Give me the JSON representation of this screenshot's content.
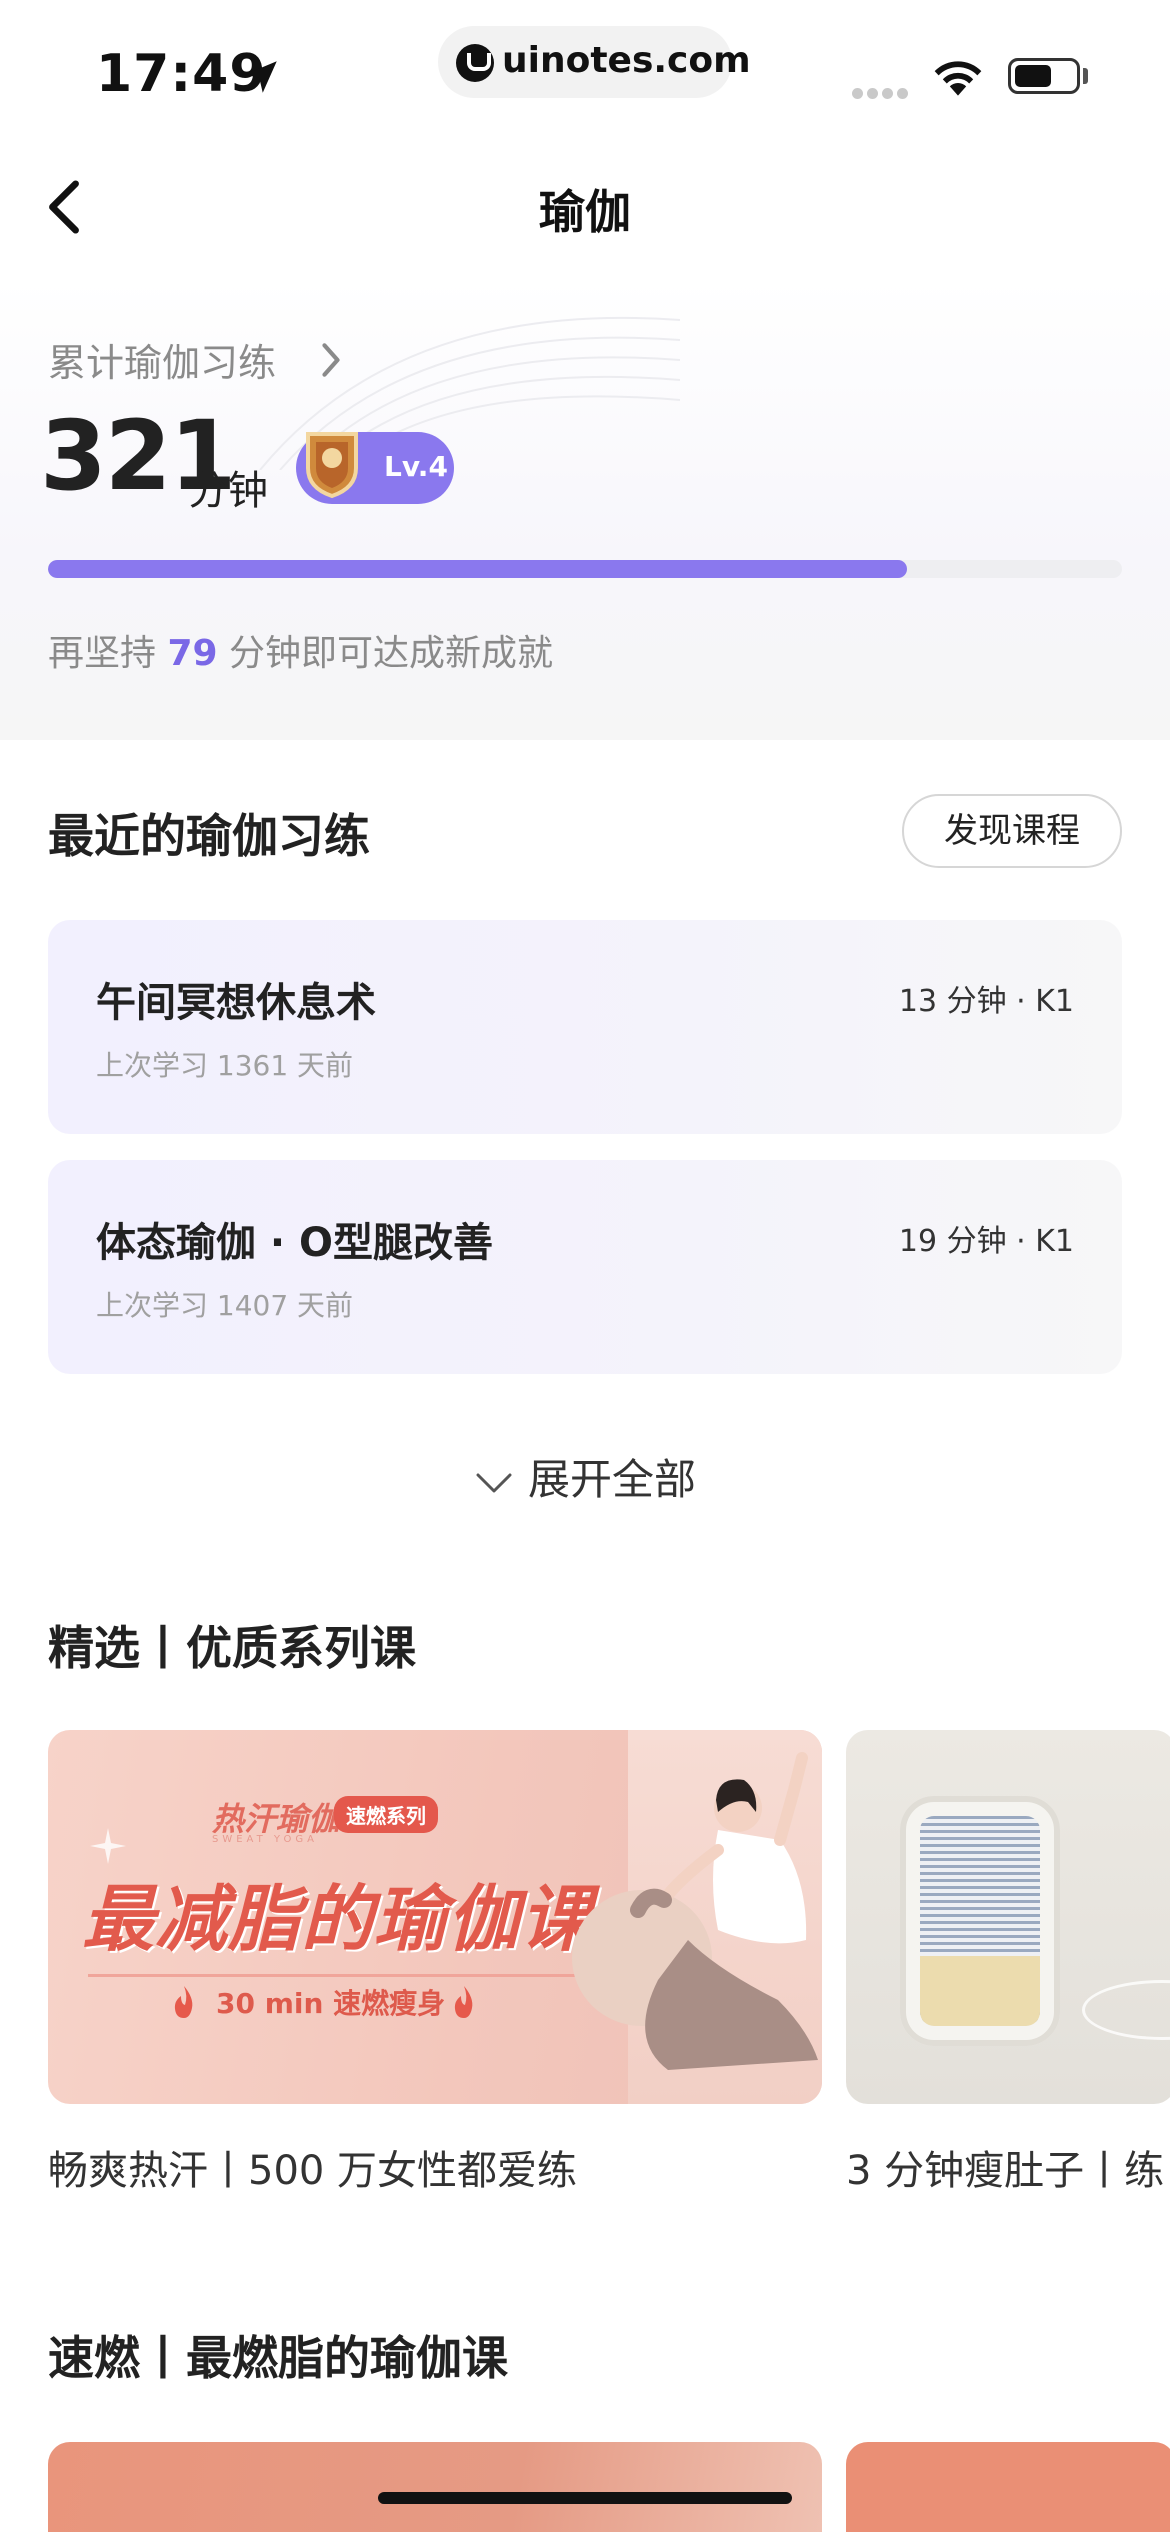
{
  "status_bar": {
    "time": "17:49",
    "url": "uinotes.com"
  },
  "nav": {
    "title": "瑜伽",
    "back_icon": "chevron-left-icon"
  },
  "stats": {
    "link_label": "累计瑜伽习练",
    "minutes": "321",
    "unit": "分钟",
    "level": "Lv.4",
    "progress_fraction": 0.8,
    "hint_prefix": "再坚持",
    "hint_number": "79",
    "hint_suffix": "分钟即可达成新成就",
    "accent_color": "#8a78ee"
  },
  "recent": {
    "title": "最近的瑜伽习练",
    "discover_button": "发现课程",
    "items": [
      {
        "name": "午间冥想休息术",
        "meta": "13 分钟 · K1",
        "last": "上次学习 1361 天前"
      },
      {
        "name": "体态瑜伽 · O型腿改善",
        "meta": "19 分钟 · K1",
        "last": "上次学习 1407 天前"
      }
    ],
    "expand_label": "展开全部"
  },
  "featured": {
    "title": "精选丨优质系列课",
    "cards": [
      {
        "caption": "畅爽热汗丨500 万女性都爱练",
        "banner_brand": "热汗瑜伽",
        "banner_sub": "SWEAT YOGA",
        "banner_tag": "速燃系列",
        "banner_main": "最减脂的瑜伽课",
        "banner_time": "30 min 速燃瘦身"
      },
      {
        "caption": "3 分钟瘦肚子丨练"
      }
    ]
  },
  "quick_burn": {
    "title": "速燃丨最燃脂的瑜伽课"
  }
}
